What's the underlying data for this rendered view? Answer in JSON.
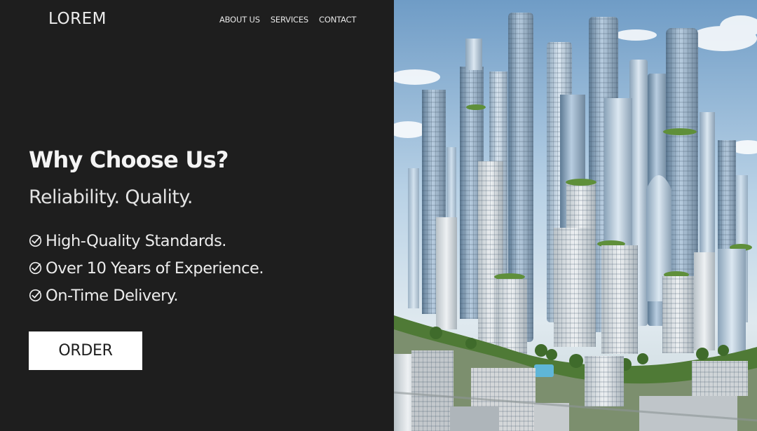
{
  "header": {
    "logo": "LOREM",
    "nav": [
      "ABOUT US",
      "SERVICES",
      "CONTACT"
    ]
  },
  "hero": {
    "title": "Why Choose Us?",
    "subtitle": "Reliability. Quality.",
    "features": [
      "High-Quality Standards.",
      "Over 10 Years of Experience.",
      "On-Time Delivery."
    ],
    "cta_label": "ORDER"
  },
  "image": {
    "subject": "futuristic city skyline illustration",
    "icon": "city-skyline"
  },
  "colors": {
    "background": "#1e1e1e",
    "text": "#f2f2f2",
    "button_bg": "#ffffff",
    "button_text": "#1e1e1e"
  }
}
